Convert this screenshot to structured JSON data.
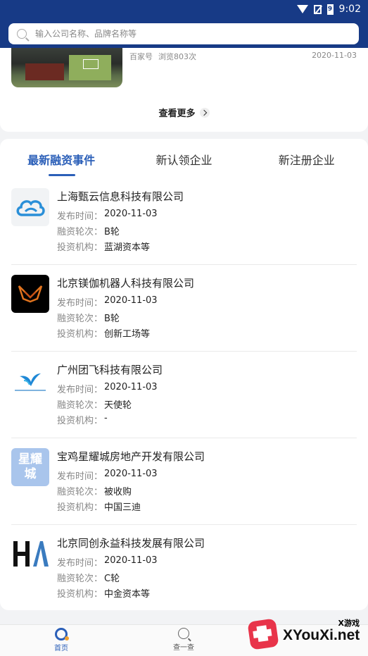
{
  "status_bar": {
    "time": "9:02",
    "battery_label": "9"
  },
  "search": {
    "placeholder": "输入公司名称、品牌名称等"
  },
  "news": {
    "source": "百家号",
    "views": "浏览803次",
    "date": "2020-11-03",
    "see_more": "查看更多"
  },
  "tabs": [
    {
      "label": "最新融资事件",
      "active": true
    },
    {
      "label": "新认领企业",
      "active": false
    },
    {
      "label": "新注册企业",
      "active": false
    }
  ],
  "labels": {
    "publish_time": "发布时间：",
    "round": "融资轮次：",
    "investor": "投资机构："
  },
  "items": [
    {
      "name": "上海甄云信息科技有限公司",
      "date": "2020-11-03",
      "round": "B轮",
      "investor": "蓝湖资本等",
      "logo": "cloud-logo"
    },
    {
      "name": "北京镁伽机器人科技有限公司",
      "date": "2020-11-03",
      "round": "B轮",
      "investor": "创新工场等",
      "logo": "mega-robotics-logo"
    },
    {
      "name": "广州团飞科技有限公司",
      "date": "2020-11-03",
      "round": "天使轮",
      "investor": "-",
      "logo": "bird-logo"
    },
    {
      "name": "宝鸡星耀城房地产开发有限公司",
      "date": "2020-11-03",
      "round": "被收购",
      "investor": "中国三迪",
      "logo": "star-city-logo",
      "logo_text": [
        "星耀",
        "城"
      ]
    },
    {
      "name": "北京同创永益科技发展有限公司",
      "date": "2020-11-03",
      "round": "C轮",
      "investor": "中金资本等",
      "logo": "ha-logo"
    }
  ],
  "bottom_nav": [
    {
      "label": "首页",
      "icon": "home-icon",
      "active": true
    },
    {
      "label": "查一查",
      "icon": "search-icon",
      "active": false
    }
  ],
  "watermark": {
    "cn": "X游戏",
    "en": "XYouXi.net"
  },
  "colors": {
    "header": "#173a86",
    "accent": "#2b5fb8"
  }
}
